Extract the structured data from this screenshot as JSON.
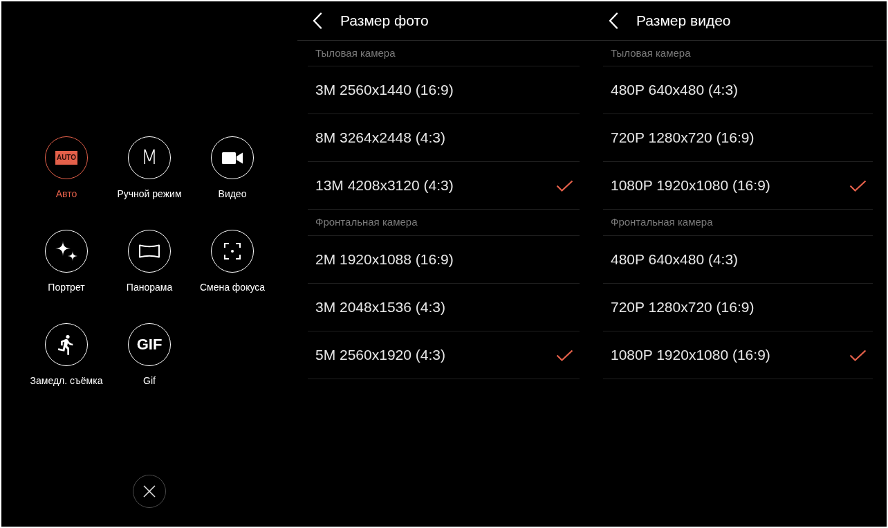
{
  "camera_modes": {
    "modes": [
      {
        "label": "Авто",
        "kind": "auto",
        "icon_text": "AUTO",
        "selected": true
      },
      {
        "label": "Ручной режим",
        "kind": "manual",
        "icon_text": "M",
        "selected": false
      },
      {
        "label": "Видео",
        "kind": "video",
        "selected": false
      },
      {
        "label": "Портрет",
        "kind": "portrait",
        "selected": false
      },
      {
        "label": "Панорама",
        "kind": "panorama",
        "selected": false
      },
      {
        "label": "Смена фокуса",
        "kind": "focus",
        "selected": false
      },
      {
        "label": "Замедл. съёмка",
        "kind": "slowmo",
        "selected": false
      },
      {
        "label": "Gif",
        "kind": "gif",
        "icon_text": "GIF",
        "selected": false
      }
    ]
  },
  "photo_size": {
    "title": "Размер фото",
    "sections": [
      {
        "heading": "Тыловая камера",
        "options": [
          {
            "label": "3M 2560x1440 (16:9)",
            "selected": false
          },
          {
            "label": "8M 3264x2448 (4:3)",
            "selected": false
          },
          {
            "label": "13M 4208x3120 (4:3)",
            "selected": true
          }
        ]
      },
      {
        "heading": "Фронтальная камера",
        "options": [
          {
            "label": "2M 1920x1088 (16:9)",
            "selected": false
          },
          {
            "label": "3M 2048x1536 (4:3)",
            "selected": false
          },
          {
            "label": "5M 2560x1920 (4:3)",
            "selected": true
          }
        ]
      }
    ]
  },
  "video_size": {
    "title": "Размер видео",
    "sections": [
      {
        "heading": "Тыловая камера",
        "options": [
          {
            "label": "480P 640x480 (4:3)",
            "selected": false
          },
          {
            "label": "720P 1280x720 (16:9)",
            "selected": false
          },
          {
            "label": "1080P 1920x1080 (16:9)",
            "selected": true
          }
        ]
      },
      {
        "heading": "Фронтальная камера",
        "options": [
          {
            "label": "480P 640x480 (4:3)",
            "selected": false
          },
          {
            "label": "720P 1280x720 (16:9)",
            "selected": false
          },
          {
            "label": "1080P 1920x1080 (16:9)",
            "selected": true
          }
        ]
      }
    ]
  }
}
